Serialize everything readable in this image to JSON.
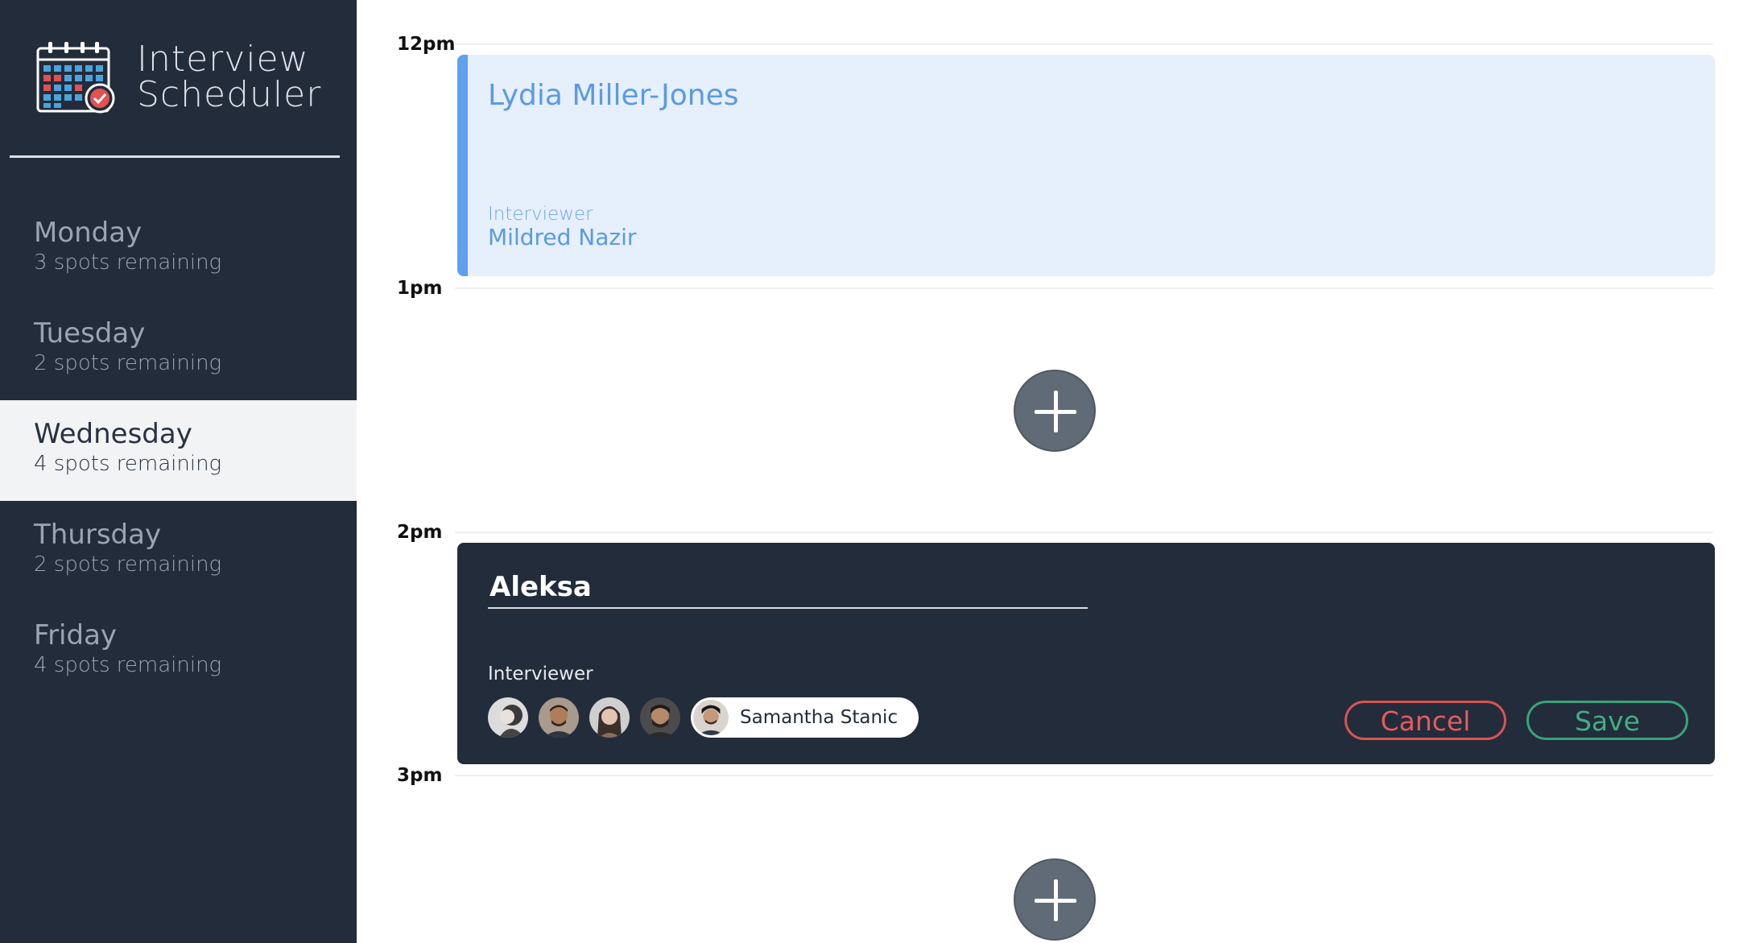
{
  "app": {
    "title_line1": "Interview",
    "title_line2": "Scheduler"
  },
  "sidebar": {
    "days": [
      {
        "name": "Monday",
        "spots": "3 spots remaining",
        "selected": false
      },
      {
        "name": "Tuesday",
        "spots": "2 spots remaining",
        "selected": false
      },
      {
        "name": "Wednesday",
        "spots": "4 spots remaining",
        "selected": true
      },
      {
        "name": "Thursday",
        "spots": "2 spots remaining",
        "selected": false
      },
      {
        "name": "Friday",
        "spots": "4 spots remaining",
        "selected": false
      }
    ]
  },
  "schedule": {
    "hours": [
      "12pm",
      "1pm",
      "2pm",
      "3pm"
    ],
    "booked": {
      "student": "Lydia Miller-Jones",
      "interviewer_label": "Interviewer",
      "interviewer_name": "Mildred Nazir"
    },
    "form": {
      "student_value": "Aleksa",
      "interviewer_label": "Interviewer",
      "interviewers": [
        {
          "name": "interviewer-1",
          "tone": "#b9b9b9"
        },
        {
          "name": "interviewer-2",
          "tone": "#8a6a55"
        },
        {
          "name": "interviewer-3",
          "tone": "#9b8478"
        },
        {
          "name": "interviewer-4",
          "tone": "#5d5a58"
        }
      ],
      "selected_interviewer": "Samantha Stanic",
      "cancel_label": "Cancel",
      "save_label": "Save"
    }
  },
  "colors": {
    "sidebar_bg": "#232c3b",
    "booked_bg": "#e6effc",
    "booked_accent": "#5ea1ee",
    "cancel": "#d9534f",
    "save": "#38a37a"
  }
}
